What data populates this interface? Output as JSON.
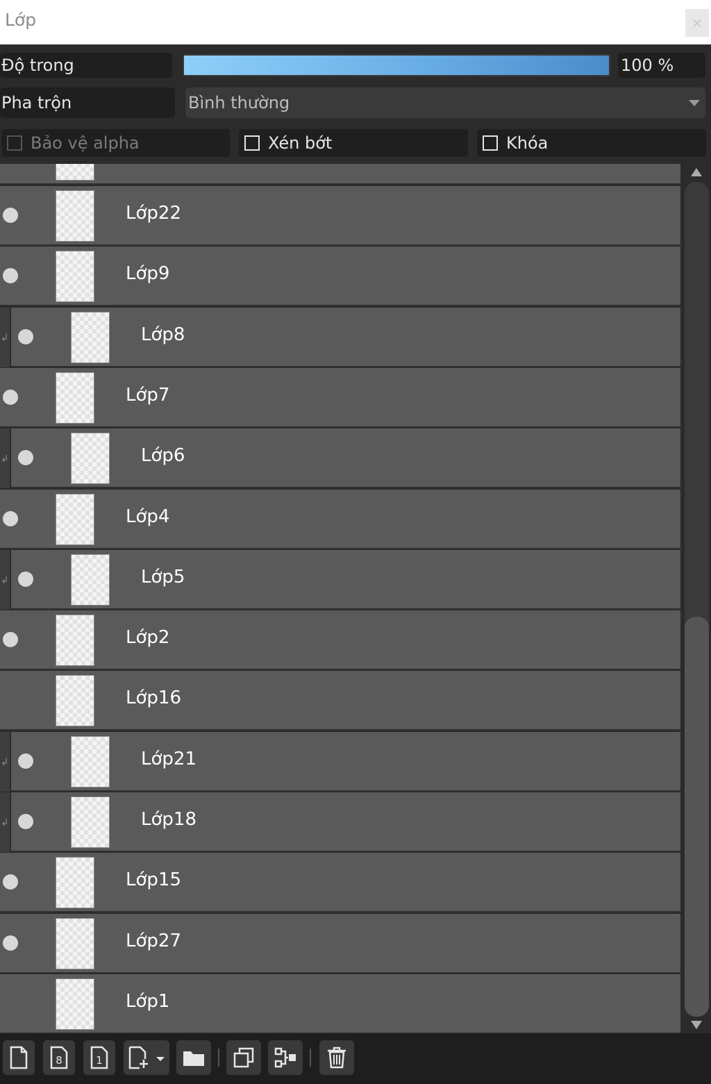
{
  "window": {
    "title": "Lớp",
    "close_glyph": "×"
  },
  "opacity": {
    "label": "Độ trong",
    "value_text": "100 %",
    "level": 1.0
  },
  "blend": {
    "label": "Pha trộn",
    "selected": "Bình thường"
  },
  "options": {
    "protect_alpha": {
      "label": "Bảo vệ alpha",
      "checked": false,
      "enabled": false
    },
    "clipping": {
      "label": "Xén bớt",
      "checked": false,
      "enabled": true
    },
    "lock": {
      "label": "Khóa",
      "checked": false,
      "enabled": true
    }
  },
  "layers": [
    {
      "name": "Lớp22",
      "visible": true,
      "clipped": false
    },
    {
      "name": "Lớp9",
      "visible": true,
      "clipped": false
    },
    {
      "name": "Lớp8",
      "visible": true,
      "clipped": true
    },
    {
      "name": "Lớp7",
      "visible": true,
      "clipped": false
    },
    {
      "name": "Lớp6",
      "visible": true,
      "clipped": true
    },
    {
      "name": "Lớp4",
      "visible": true,
      "clipped": false
    },
    {
      "name": "Lớp5",
      "visible": true,
      "clipped": true
    },
    {
      "name": "Lớp2",
      "visible": true,
      "clipped": false
    },
    {
      "name": "Lớp16",
      "visible": false,
      "clipped": false
    },
    {
      "name": "Lớp21",
      "visible": true,
      "clipped": true
    },
    {
      "name": "Lớp18",
      "visible": true,
      "clipped": true
    },
    {
      "name": "Lớp15",
      "visible": true,
      "clipped": false
    },
    {
      "name": "Lớp27",
      "visible": true,
      "clipped": false
    },
    {
      "name": "Lớp1",
      "visible": false,
      "clipped": false
    }
  ],
  "toolbar": {
    "buttons": [
      {
        "icon": "new-layer-icon"
      },
      {
        "icon": "new-8bit-layer-icon"
      },
      {
        "icon": "new-1bit-layer-icon"
      },
      {
        "icon": "add-layer-menu-icon"
      },
      {
        "icon": "new-folder-icon"
      },
      {
        "icon": "duplicate-layer-icon"
      },
      {
        "icon": "merge-down-icon"
      },
      {
        "icon": "delete-layer-icon"
      }
    ]
  },
  "colors": {
    "accent": "#6aaee6",
    "row_bg": "#5a5a5a",
    "panel_bg": "#2b2b2b"
  }
}
